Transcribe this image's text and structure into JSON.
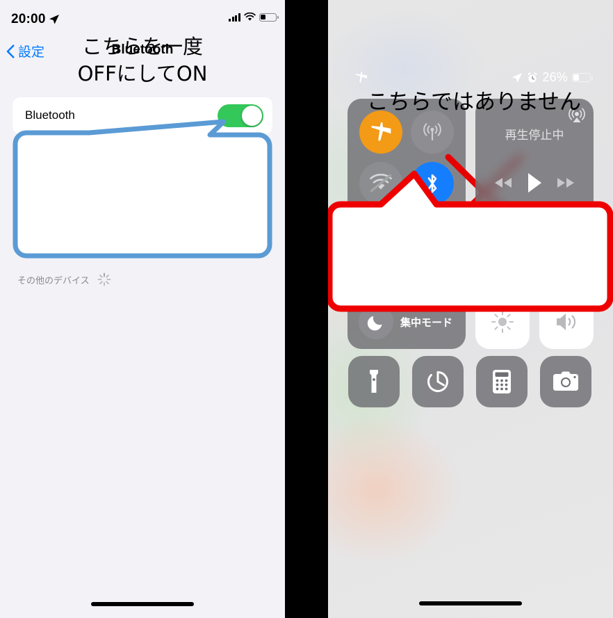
{
  "left_phone": {
    "status_bar": {
      "time": "20:00",
      "location_icon": "location-arrow-icon",
      "signal_icon": "cellular-bars-icon",
      "wifi_icon": "wifi-icon",
      "battery_icon": "battery-low-icon"
    },
    "nav": {
      "back_label": "設定",
      "back_icon": "chevron-left-icon",
      "title": "Bluetooth"
    },
    "bluetooth_row": {
      "label": "Bluetooth",
      "toggle_state": "on",
      "toggle_on_color": "#34c759"
    },
    "callout": {
      "line1": "こちらを一度",
      "line2": "OFFにしてON",
      "border_color": "#5b9bd5"
    },
    "other_devices": {
      "label": "その他のデバイス",
      "spinner_icon": "activity-spinner-icon"
    },
    "home_indicator": "home-indicator"
  },
  "right_phone": {
    "status_bar": {
      "airplane_icon": "airplane-icon",
      "location_icon": "location-arrow-icon",
      "alarm_icon": "alarm-clock-icon",
      "battery_percent": "26%",
      "battery_icon": "battery-low-icon"
    },
    "connectivity": {
      "airplane": {
        "icon": "airplane-icon",
        "state": "on",
        "color": "#f39a16"
      },
      "cellular": {
        "icon": "cellular-antenna-icon",
        "state": "off"
      },
      "wifi": {
        "icon": "wifi-off-icon",
        "state": "off"
      },
      "bluetooth": {
        "icon": "bluetooth-icon",
        "state": "on",
        "color": "#157eff"
      }
    },
    "media": {
      "status_text": "再生停止中",
      "airplay_icon": "airplay-audio-icon",
      "rewind_icon": "rewind-icon",
      "play_icon": "play-icon",
      "forward_icon": "fast-forward-icon"
    },
    "focus": {
      "label": "集中モード",
      "icon": "moon-icon"
    },
    "brightness": {
      "icon": "brightness-sun-icon",
      "level": "100"
    },
    "volume": {
      "icon": "speaker-volume-icon",
      "level": "100"
    },
    "shortcuts": [
      {
        "name": "flashlight",
        "icon": "flashlight-icon"
      },
      {
        "name": "timer",
        "icon": "timer-icon"
      },
      {
        "name": "calculator",
        "icon": "calculator-icon"
      },
      {
        "name": "camera",
        "icon": "camera-icon"
      }
    ],
    "callout": {
      "text": "こちらではありません",
      "border_color": "#ee0000"
    },
    "cross_mark": {
      "icon": "red-x-cross-icon",
      "color": "#e60000"
    },
    "home_indicator": "home-indicator"
  }
}
